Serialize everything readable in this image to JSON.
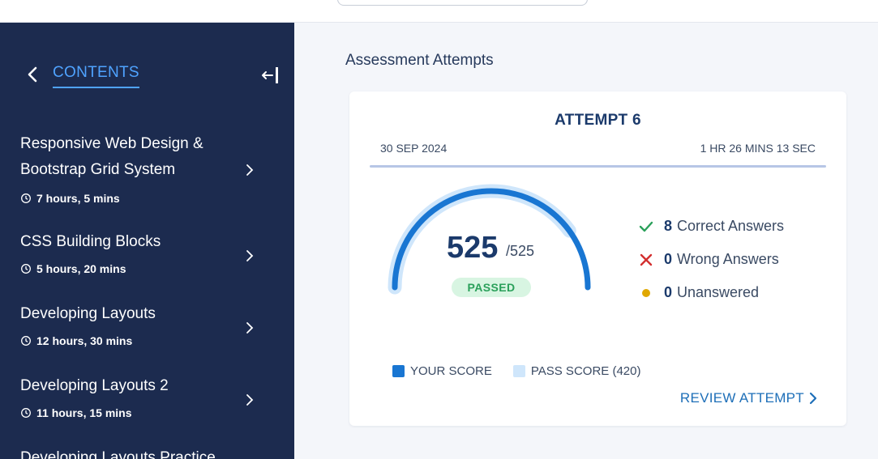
{
  "sidebar": {
    "title": "CONTENTS",
    "courses": [
      {
        "name": "Responsive Web Design & Bootstrap Grid System",
        "duration": "7 hours, 5 mins"
      },
      {
        "name": "CSS Building Blocks",
        "duration": "5 hours, 20 mins"
      },
      {
        "name": "Developing Layouts",
        "duration": "12 hours, 30 mins"
      },
      {
        "name": "Developing Layouts 2",
        "duration": "11 hours, 15 mins"
      },
      {
        "name": "Developing Layouts Practice",
        "duration": ""
      }
    ]
  },
  "main": {
    "title": "Assessment Attempts"
  },
  "attempt": {
    "title": "ATTEMPT 6",
    "date": "30 SEP 2024",
    "duration": "1 HR 26 MINS 13 SEC",
    "score": "525",
    "max_score": "/525",
    "score_value": 525,
    "max_value": 525,
    "pass_value": 420,
    "status": "PASSED",
    "stats": {
      "correct_count": "8",
      "correct_label": "Correct Answers",
      "wrong_count": "0",
      "wrong_label": "Wrong Answers",
      "unanswered_count": "0",
      "unanswered_label": "Unanswered"
    },
    "legend": {
      "your_score": "YOUR SCORE",
      "pass_score": "PASS SCORE (420)"
    },
    "review_label": "REVIEW ATTEMPT"
  },
  "colors": {
    "sidebar_bg": "#1c2b4f",
    "accent": "#4fa3ff",
    "score_arc": "#1976d2",
    "pass_arc": "#cfe6fb",
    "passed_bg": "#d8f5e2",
    "passed_text": "#2aa05a",
    "correct": "#2aa05a",
    "wrong": "#d32f2f",
    "unanswered": "#e0a800"
  }
}
